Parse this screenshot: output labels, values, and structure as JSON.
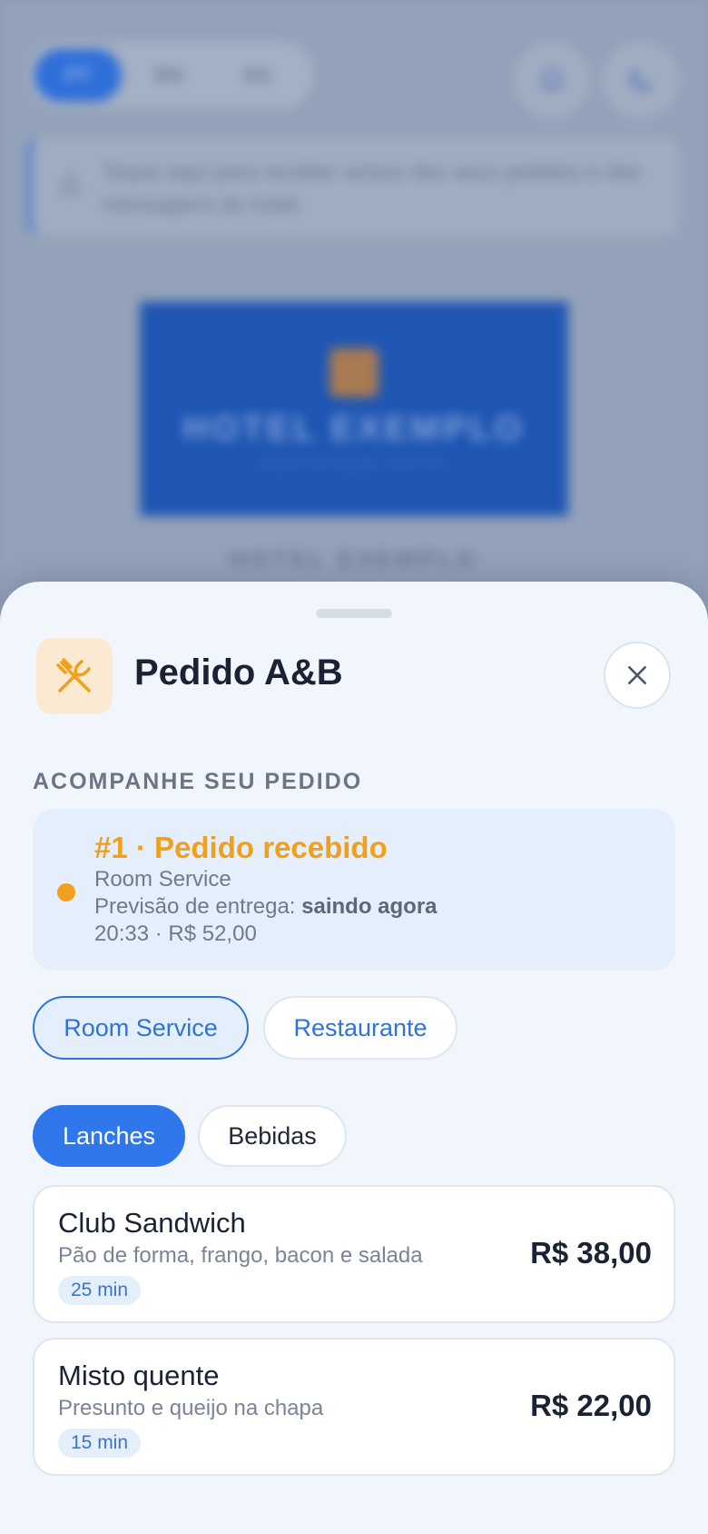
{
  "background": {
    "languages": [
      {
        "code": "PT",
        "active": true
      },
      {
        "code": "EN",
        "active": false
      },
      {
        "code": "ES",
        "active": false
      }
    ],
    "notification_button": {
      "icon": "bell-icon"
    },
    "theme_button": {
      "icon": "moon-icon"
    },
    "notice_text": "Toque aqui para receber avisos dos seus pedidos e das mensagens do hotel.",
    "logo_name": "HOTEL EXEMPLO",
    "logo_sub": "HOSPITALIDADE DIGITAL",
    "hotel_caption": "HOTEL EXEMPLO"
  },
  "sheet": {
    "icon": "utensils-icon",
    "title": "Pedido A&B",
    "close_icon": "close-icon",
    "section_label": "ACOMPANHE SEU PEDIDO",
    "order": {
      "title": "#1 · Pedido recebido",
      "service": "Room Service",
      "eta_label": "Previsão de entrega:",
      "eta_value": "saindo agora",
      "meta": "20:33 · R$ 52,00",
      "status_color": "#f0a01c"
    },
    "service_tabs": [
      {
        "label": "Room Service",
        "active": true
      },
      {
        "label": "Restaurante",
        "active": false
      }
    ],
    "category_tabs": [
      {
        "label": "Lanches",
        "active": true
      },
      {
        "label": "Bebidas",
        "active": false
      }
    ],
    "items": [
      {
        "name": "Club Sandwich",
        "description": "Pão de forma, frango, bacon e salada",
        "time": "25 min",
        "price": "R$ 38,00"
      },
      {
        "name": "Misto quente",
        "description": "Presunto e queijo na chapa",
        "time": "15 min",
        "price": "R$ 22,00"
      }
    ]
  },
  "colors": {
    "accent": "#2f77eb",
    "status": "#f0a01c",
    "sheet_bg": "#f1f6fd"
  }
}
